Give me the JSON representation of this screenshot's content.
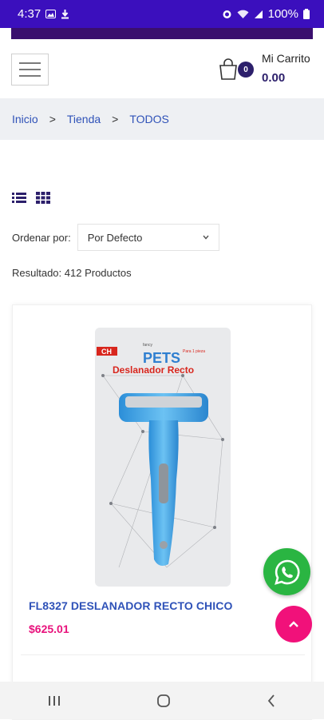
{
  "status_bar": {
    "time": "4:37",
    "battery": "100%"
  },
  "header": {
    "cart_label": "Mi Carrito",
    "cart_total": "0.00",
    "cart_count": "0"
  },
  "breadcrumb": {
    "items": [
      "Inicio",
      "Tienda",
      "TODOS"
    ],
    "separator": ">"
  },
  "toolbar": {
    "sort_label": "Ordenar por:",
    "sort_value": "Por Defecto",
    "result_text": "Resultado: 412 Productos"
  },
  "product": {
    "name": "FL8327 DESLANADOR RECTO CHICO",
    "price": "$625.01",
    "package": {
      "badge": "CH",
      "brand": "PETS",
      "brand_prefix": "fancy",
      "title": "Deslanador Recto",
      "side_note": "Para 1 pieza"
    }
  },
  "colors": {
    "status_bar": "#3b0fbd",
    "accent_link": "#2f52b8",
    "price": "#e8127c",
    "whatsapp": "#2ab542",
    "scroll_top": "#f1117a",
    "cart_badge": "#2c1f6b"
  },
  "icons": {
    "menu": "hamburger-icon",
    "cart": "shopping-bag-icon",
    "list_view": "list-view-icon",
    "grid_view": "grid-view-icon",
    "whatsapp": "whatsapp-icon",
    "scroll_top": "chevron-up-icon"
  }
}
